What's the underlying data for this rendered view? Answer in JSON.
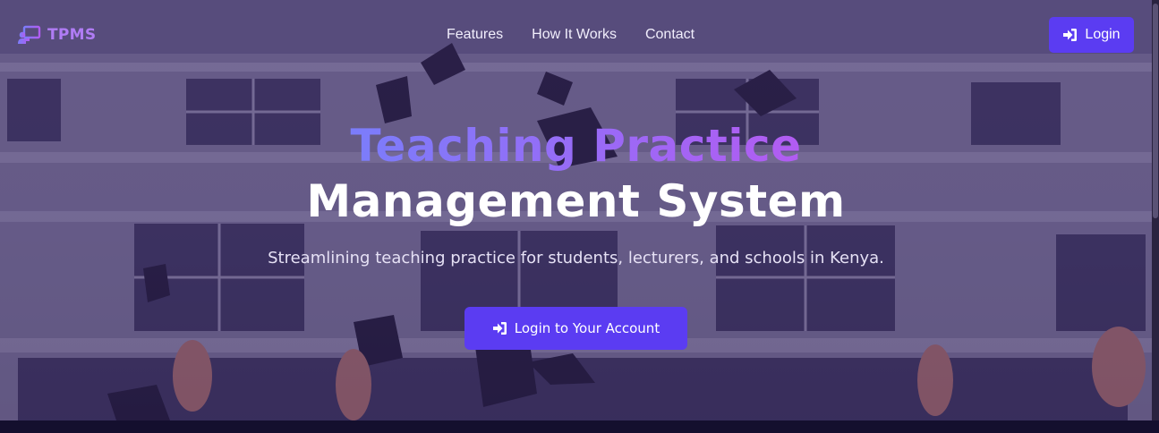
{
  "brand": {
    "name": "TPMS",
    "icon": "chalkboard-teacher-icon"
  },
  "nav": {
    "links": [
      "Features",
      "How It Works",
      "Contact"
    ],
    "login_label": "Login",
    "login_icon": "sign-in-icon"
  },
  "hero": {
    "title_line1": "Teaching Practice",
    "title_line2": "Management System",
    "subtitle": "Streamlining teaching practice for students, lecturers, and schools in Kenya.",
    "cta_label": "Login to Your Account",
    "cta_icon": "sign-in-icon"
  },
  "colors": {
    "accent": "#5b3cf2",
    "brand_text": "#b07cf5",
    "gradient_start": "#7b7dfa",
    "gradient_end": "#b25cf2",
    "overlay": "#2f2060"
  }
}
